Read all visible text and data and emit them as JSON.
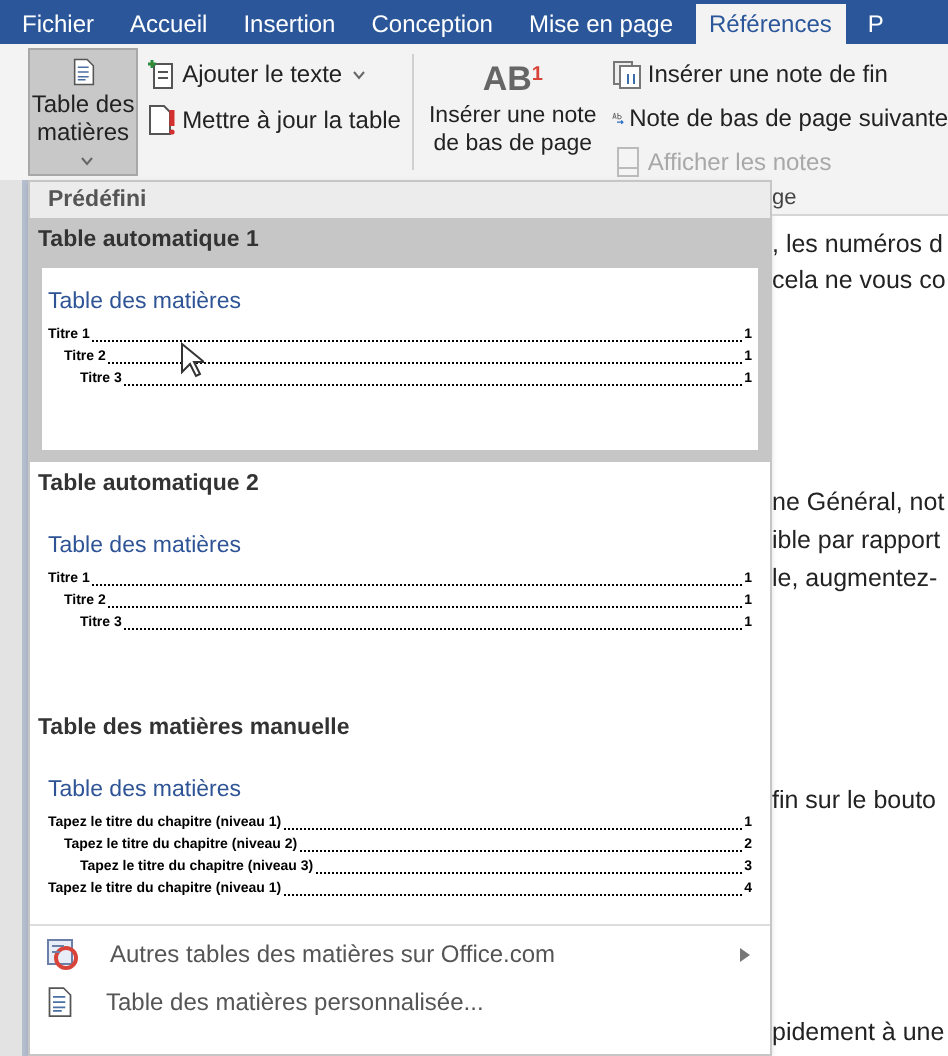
{
  "tabs": [
    {
      "label": "Fichier",
      "selected": false
    },
    {
      "label": "Accueil",
      "selected": false
    },
    {
      "label": "Insertion",
      "selected": false
    },
    {
      "label": "Conception",
      "selected": false
    },
    {
      "label": "Mise en page",
      "selected": false
    },
    {
      "label": "Références",
      "selected": true
    },
    {
      "label": "P",
      "selected": false
    }
  ],
  "ribbon": {
    "toc_button": {
      "label": "Table des matières",
      "pressed": true
    },
    "toc_small": [
      {
        "label": "Ajouter le texte",
        "dropdown": true,
        "kind": "add-text"
      },
      {
        "label": "Mettre à jour la table",
        "dropdown": false,
        "kind": "update"
      }
    ],
    "footnote_button": {
      "icon_text": "AB",
      "icon_sup": "1",
      "label": "Insérer une note de bas de page"
    },
    "footnote_small": [
      {
        "label": "Insérer une note de fin",
        "disabled": false,
        "kind": "endnote"
      },
      {
        "label": "Note de bas de page suivante",
        "disabled": false,
        "kind": "next"
      },
      {
        "label": "Afficher les notes",
        "disabled": true,
        "kind": "show"
      }
    ]
  },
  "dropdown": {
    "header": "Prédéfini",
    "gallery": [
      {
        "title": "Table automatique 1",
        "selected": true,
        "heading": "Table des matières",
        "kind": "auto",
        "lines": [
          {
            "text": "Titre 1",
            "page": "1",
            "children": [
              {
                "text": "Titre 2",
                "page": "1",
                "children": [
                  {
                    "text": "Titre 3",
                    "page": "1"
                  }
                ]
              }
            ]
          }
        ]
      },
      {
        "title": "Table automatique 2",
        "selected": false,
        "heading": "Table des matières",
        "kind": "auto",
        "lines": [
          {
            "text": "Titre 1",
            "page": "1",
            "children": [
              {
                "text": "Titre 2",
                "page": "1",
                "children": [
                  {
                    "text": "Titre 3",
                    "page": "1"
                  }
                ]
              }
            ]
          }
        ]
      },
      {
        "title": "Table des matières manuelle",
        "selected": false,
        "heading": "Table des matières",
        "kind": "manual",
        "lines": [
          {
            "text": "Tapez le titre du chapitre (niveau 1)",
            "page": "1",
            "children": [
              {
                "text": "Tapez le titre du chapitre (niveau 2)",
                "page": "2",
                "children": [
                  {
                    "text": "Tapez le titre du chapitre (niveau 3)",
                    "page": "3"
                  }
                ]
              }
            ]
          },
          {
            "text": "Tapez le titre du chapitre (niveau 1)",
            "page": "4"
          }
        ]
      }
    ],
    "menu": [
      {
        "label": "Autres tables des matières sur Office.com",
        "submenu": true,
        "kind": "office"
      },
      {
        "label": "Table des matières personnalisée...",
        "submenu": false,
        "kind": "custom"
      }
    ]
  },
  "document": {
    "group_label": "ge",
    "lines": [
      ", les numéros d",
      "cela ne vous co",
      "ne Général, not",
      "ible par rapport",
      "le, augmentez-",
      "fin sur le bouto",
      "pidement à une"
    ]
  }
}
